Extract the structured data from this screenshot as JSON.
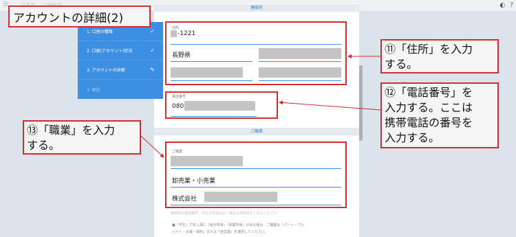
{
  "title": "アカウントの詳細(2)",
  "topbar": {
    "menu_icon": "☰",
    "faded_a": "日本語",
    "faded_b": "口座開設",
    "half_icon": "◐",
    "help_icon": "?"
  },
  "steps": [
    {
      "label": "1. 口座の種類",
      "mark": "✓"
    },
    {
      "label": "2. 口座[アカウント]状況",
      "mark": "✓"
    },
    {
      "label": "3. アカウントの詳細",
      "mark": "✎"
    },
    {
      "label": "4. 確認",
      "mark": ""
    }
  ],
  "contact": {
    "header": "連絡先",
    "address_label": "住所",
    "postal_visible": "-1221",
    "prefecture": "長野県",
    "phone_label": "電話番号",
    "phone_prefix": "080"
  },
  "occupation": {
    "header": "ご職業",
    "field_label": "ご職業",
    "industry": "卸売業・小売業",
    "company": "株式会社",
    "note1": "勤務先の電話番号、学生で所得のない場合は学校名をご記入ください。",
    "note2": "■「学生」で収入源に「給与所得」「事業所得」がある場合、ご職業は「パート・アル",
    "note3": "バイト・派遣・契約」または「自営業」を選択してください。"
  },
  "callouts": {
    "c11_line1": "⑪「住所」を入力",
    "c11_line2": "する。",
    "c12_line1": "⑫「電話番号」を",
    "c12_line2": "入力する。ここは",
    "c12_line3": "携帯電話の番号を",
    "c12_line4": "入力する。",
    "c13_line1": "⑬「職業」を入力",
    "c13_line2": "する。"
  },
  "colors": {
    "accent_blue": "#3c8fe3",
    "highlight_red": "#d42a2a"
  }
}
